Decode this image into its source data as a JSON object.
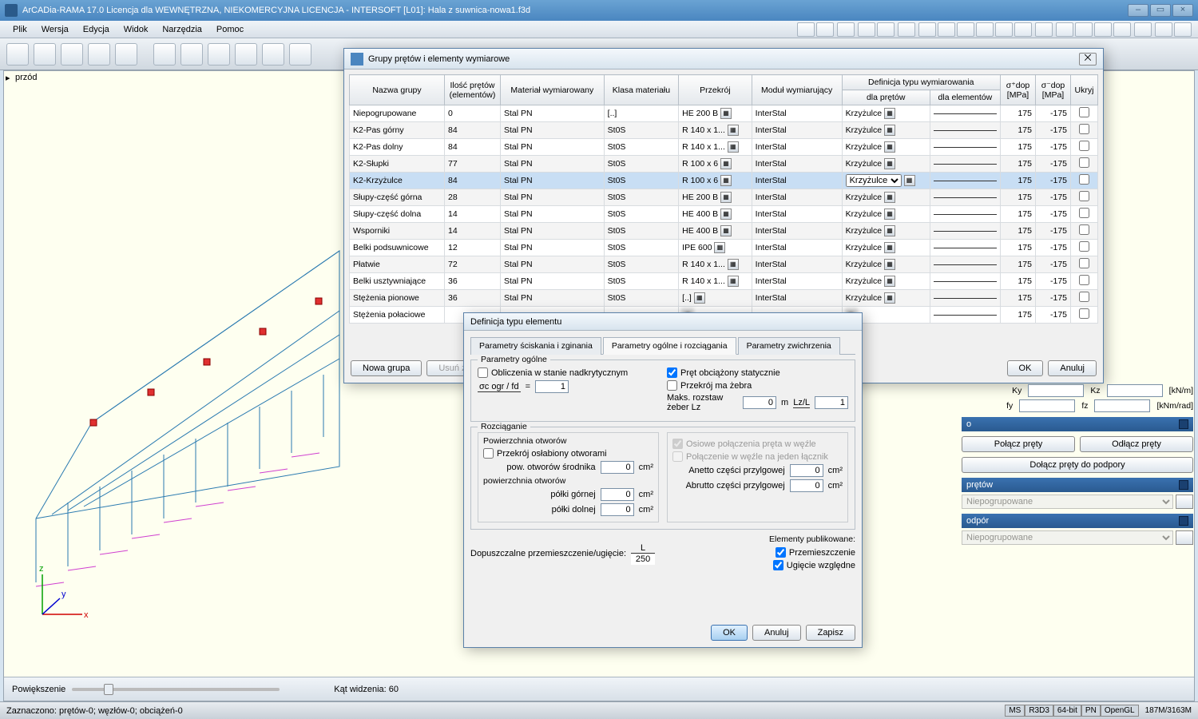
{
  "title": "ArCADia-RAMA 17.0 Licencja dla WEWNĘTRZNA, NIEKOMERCYJNA LICENCJA - INTERSOFT [L01]: Hala z suwnica-nowa1.f3d",
  "menu": {
    "plik": "Plik",
    "wersja": "Wersja",
    "edycja": "Edycja",
    "widok": "Widok",
    "narzedzia": "Narzędzia",
    "pomoc": "Pomoc"
  },
  "viewport": {
    "label": "przód",
    "zoom_label": "Powiększenie",
    "fov_label": "Kąt widzenia: 60"
  },
  "status": {
    "left": "Zaznaczono: prętów-0; węzłów-0; obciążeń-0",
    "tags": [
      "MS",
      "R3D3",
      "64-bit",
      "PN",
      "OpenGL"
    ],
    "mem": "187M/3163M"
  },
  "dlg1": {
    "title": "Grupy prętów i elementy wymiarowe",
    "hdr": {
      "nazwa": "Nazwa grupy",
      "ilosc": "Ilość prętów (elementów)",
      "material": "Materiał wymiarowany",
      "klasa": "Klasa materiału",
      "przekroj": "Przekrój",
      "modul": "Moduł wymiarujący",
      "def": "Definicja typu wymiarowania",
      "defp": "dla prętów",
      "defe": "dla elementów",
      "sp": "σ⁺dop [MPa]",
      "sm": "σ⁻dop [MPa]",
      "ukryj": "Ukryj"
    },
    "rows": [
      {
        "n": "Niepogrupowane",
        "i": "0",
        "m": "Stal PN",
        "k": "[..]",
        "p": "HE 200 B",
        "mo": "InterStal",
        "d": "Krzyżulce",
        "sp": "175",
        "sm": "-175",
        "sel": false,
        "alt": false
      },
      {
        "n": "K2-Pas górny",
        "i": "84",
        "m": "Stal PN",
        "k": "St0S",
        "p": "R 140 x 1...",
        "mo": "InterStal",
        "d": "Krzyżulce",
        "sp": "175",
        "sm": "-175",
        "sel": false,
        "alt": true
      },
      {
        "n": "K2-Pas dolny",
        "i": "84",
        "m": "Stal PN",
        "k": "St0S",
        "p": "R 140 x 1...",
        "mo": "InterStal",
        "d": "Krzyżulce",
        "sp": "175",
        "sm": "-175",
        "sel": false,
        "alt": false
      },
      {
        "n": "K2-Słupki",
        "i": "77",
        "m": "Stal PN",
        "k": "St0S",
        "p": "R 100 x 6",
        "mo": "InterStal",
        "d": "Krzyżulce",
        "sp": "175",
        "sm": "-175",
        "sel": false,
        "alt": true
      },
      {
        "n": "K2-Krzyżulce",
        "i": "84",
        "m": "Stal PN",
        "k": "St0S",
        "p": "R 100 x 6",
        "mo": "InterStal",
        "d": "Krzyżulce",
        "sp": "175",
        "sm": "-175",
        "sel": true,
        "alt": false
      },
      {
        "n": "Słupy-część górna",
        "i": "28",
        "m": "Stal PN",
        "k": "St0S",
        "p": "HE 200 B",
        "mo": "InterStal",
        "d": "Krzyżulce",
        "sp": "175",
        "sm": "-175",
        "sel": false,
        "alt": true
      },
      {
        "n": "Słupy-część dolna",
        "i": "14",
        "m": "Stal PN",
        "k": "St0S",
        "p": "HE 400 B",
        "mo": "InterStal",
        "d": "Krzyżulce",
        "sp": "175",
        "sm": "-175",
        "sel": false,
        "alt": false
      },
      {
        "n": "Wsporniki",
        "i": "14",
        "m": "Stal PN",
        "k": "St0S",
        "p": "HE 400 B",
        "mo": "InterStal",
        "d": "Krzyżulce",
        "sp": "175",
        "sm": "-175",
        "sel": false,
        "alt": true
      },
      {
        "n": "Belki podsuwnicowe",
        "i": "12",
        "m": "Stal PN",
        "k": "St0S",
        "p": "IPE 600",
        "mo": "InterStal",
        "d": "Krzyżulce",
        "sp": "175",
        "sm": "-175",
        "sel": false,
        "alt": false
      },
      {
        "n": "Płatwie",
        "i": "72",
        "m": "Stal PN",
        "k": "St0S",
        "p": "R 140 x 1...",
        "mo": "InterStal",
        "d": "Krzyżulce",
        "sp": "175",
        "sm": "-175",
        "sel": false,
        "alt": true
      },
      {
        "n": "Belki usztywniające",
        "i": "36",
        "m": "Stal PN",
        "k": "St0S",
        "p": "R 140 x 1...",
        "mo": "InterStal",
        "d": "Krzyżulce",
        "sp": "175",
        "sm": "-175",
        "sel": false,
        "alt": false
      },
      {
        "n": "Stężenia pionowe",
        "i": "36",
        "m": "Stal PN",
        "k": "St0S",
        "p": "[..]",
        "mo": "InterStal",
        "d": "Krzyżulce",
        "sp": "175",
        "sm": "-175",
        "sel": false,
        "alt": true
      },
      {
        "n": "Stężenia połaciowe",
        "i": "",
        "m": "",
        "k": "",
        "p": "",
        "mo": "",
        "d": "",
        "sp": "175",
        "sm": "-175",
        "sel": false,
        "alt": false,
        "blur": true
      }
    ],
    "btn": {
      "nowa": "Nowa grupa",
      "usun": "Usuń zaz",
      "ok": "OK",
      "anuluj": "Anuluj"
    }
  },
  "rpanel": {
    "ky": "Ky",
    "kz": "Kz",
    "u1": "[kN/m]",
    "fy": "fy",
    "fz": "fz",
    "u2": "[kNm/rad]",
    "polacz": "Połącz pręty",
    "odlacz": "Odłącz pręty",
    "dolacz": "Dołącz pręty do podpory",
    "h1": "prętów",
    "h2": "odpór",
    "c1": "Niepogrupowane",
    "c2": "Niepogrupowane"
  },
  "dlg2": {
    "title": "Definicja typu elementu",
    "tabs": {
      "t1": "Parametry ściskania i zginania",
      "t2": "Parametry ogólne i rozciągania",
      "t3": "Parametry zwichrzenia"
    },
    "pg": {
      "hdr": "Parametry ogólne",
      "obl": "Obliczenia w stanie nadkrytycznym",
      "ratio": "σc ogr / fd",
      "eq": "=",
      "v1": "1",
      "pret": "Pręt obciążony statycznie",
      "zebra": "Przekrój ma żebra",
      "maks": "Maks. rozstaw żeber  Lz",
      "vlz": "0",
      "m": "m",
      "lzl": "Lz/L",
      "vlzl": "1"
    },
    "roz": {
      "hdr": "Rozciąganie",
      "pow": "Powierzchnia otworów",
      "osl": "Przekrój osłabiony otworami",
      "psr": "pow. otworów środnika",
      "v1": "0",
      "cm2": "cm²",
      "pot": "powierzchnia otworów",
      "pg": "półki górnej",
      "v2": "0",
      "pd": "półki dolnej",
      "v3": "0",
      "osio": "Osiowe połączenia pręta w węźle",
      "pol": "Połączenie w węźle na jeden łącznik",
      "anetto": "Anetto  części przylgowej",
      "v4": "0",
      "abrutto": "Abrutto  części przylgowej",
      "v5": "0"
    },
    "dop": {
      "l": "Dopuszczalne przemieszczenie/ugięcie:",
      "L": "L",
      "d": "250"
    },
    "pub": {
      "h": "Elementy publikowane:",
      "p": "Przemieszczenie",
      "u": "Ugięcie względne"
    },
    "btn": {
      "ok": "OK",
      "anuluj": "Anuluj",
      "zapisz": "Zapisz"
    }
  }
}
